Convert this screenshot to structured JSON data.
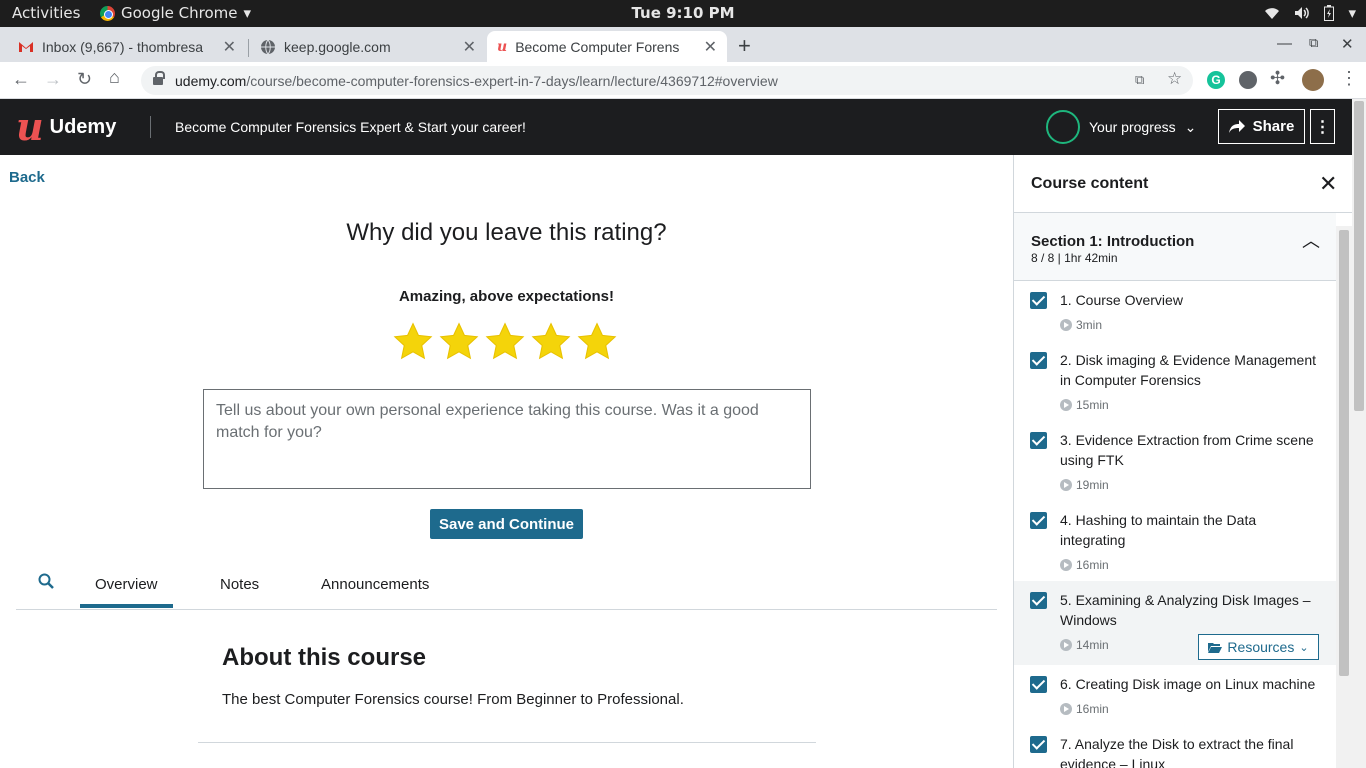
{
  "os": {
    "activities": "Activities",
    "app_name": "Google Chrome",
    "clock": "Tue  9:10 PM"
  },
  "browser": {
    "tabs": [
      {
        "title": "Inbox (9,667) - thombresa",
        "icon": "gmail-icon"
      },
      {
        "title": "keep.google.com",
        "icon": "globe-icon"
      },
      {
        "title": "Become Computer Forens",
        "icon": "udemy-icon"
      }
    ],
    "url_host": "udemy.com",
    "url_path": "/course/become-computer-forensics-expert-in-7-days/learn/lecture/4369712#overview"
  },
  "header": {
    "logo_text": "Udemy",
    "course_title": "Become Computer Forensics Expert & Start your career!",
    "progress_label": "Your progress",
    "share_label": "Share"
  },
  "main": {
    "back_label": "Back",
    "rating_question": "Why did you leave this rating?",
    "rating_description": "Amazing, above expectations!",
    "rating_value": 5,
    "rating_max": 5,
    "feedback_placeholder": "Tell us about your own personal experience taking this course. Was it a good match for you?",
    "save_label": "Save and Continue",
    "tabs": [
      {
        "label": "Overview",
        "active": true
      },
      {
        "label": "Notes",
        "active": false
      },
      {
        "label": "Announcements",
        "active": false
      }
    ],
    "about_title": "About this course",
    "about_description": "The best Computer Forensics course! From Beginner to Professional."
  },
  "sidebar": {
    "title": "Course content",
    "section": {
      "title": "Section 1: Introduction",
      "meta": "8 / 8 | 1hr 42min"
    },
    "lectures": [
      {
        "title": "1. Course Overview",
        "duration": "3min",
        "done": true
      },
      {
        "title": "2. Disk imaging & Evidence Management in Computer Forensics",
        "duration": "15min",
        "done": true
      },
      {
        "title": "3. Evidence Extraction from Crime scene using FTK",
        "duration": "19min",
        "done": true
      },
      {
        "title": "4. Hashing to maintain the Data integrating",
        "duration": "16min",
        "done": true
      },
      {
        "title": "5. Examining & Analyzing Disk Images – Windows",
        "duration": "14min",
        "done": true,
        "resources_label": "Resources"
      },
      {
        "title": "6. Creating Disk image on Linux machine",
        "duration": "16min",
        "done": true
      },
      {
        "title": "7. Analyze the Disk to extract the final evidence – Linux",
        "duration": "",
        "done": true
      }
    ]
  },
  "colors": {
    "brand": "#ec5252",
    "accent": "#1e6a8d",
    "star": "#f4d40a",
    "header_bg": "#1c1d1f",
    "progress_ring": "#1eb67d"
  }
}
